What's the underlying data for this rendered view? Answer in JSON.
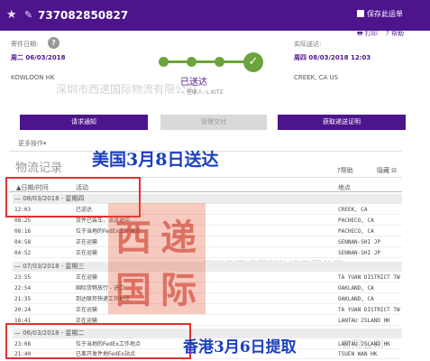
{
  "header": {
    "tracking_number": "737082850827",
    "save_label": "保存此运单"
  },
  "links": {
    "print": "打印",
    "help": "帮助"
  },
  "shipment": {
    "ship_date_label": "寄件日期:",
    "ship_date": "周二 06/03/2018",
    "origin": "KOWLOON HK",
    "delivered_label": "实际送达:",
    "delivered_date": "周四 08/03/2018 12:03",
    "destination": "CREEK, CA US"
  },
  "status": {
    "title": "已送达",
    "signed_by": "签收人: L.KITZ"
  },
  "buttons": {
    "notify": "请求通知",
    "manage": "管理交付",
    "proof": "获取递送证明"
  },
  "more_actions": "更多操作▾",
  "history": {
    "title": "物流记录",
    "help": "帮助",
    "hide": "隐藏",
    "col_date": "▲日期/时间",
    "col_activity": "活动",
    "col_location": "地点",
    "groups": [
      {
        "header": "—  08/03/2018 - 星期四",
        "rows": [
          {
            "time": "12:03",
            "activity": "已送达",
            "location": "CREEK, CA"
          },
          {
            "time": "08:25",
            "activity": "货件已装车，派送途中",
            "location": "PACHECO, CA"
          },
          {
            "time": "08:16",
            "activity": "位于当地的FedEx工作地点",
            "location": "PACHECO, CA"
          },
          {
            "time": "04:58",
            "activity": "正在运输",
            "location": "SENNAN-SHI JP"
          },
          {
            "time": "04:52",
            "activity": "正在运输",
            "location": "SENNAN-SHI JP"
          }
        ]
      },
      {
        "header": "—  07/03/2018 - 星期三",
        "rows": [
          {
            "time": "23:55",
            "activity": "正在运输",
            "location": "TA YUAN DISTRICT TW"
          },
          {
            "time": "22:54",
            "activity": "国际货物放行 - 进口",
            "location": "OAKLAND, CA"
          },
          {
            "time": "21:35",
            "activity": "到达联邦快递工作地点",
            "location": "OAKLAND, CA"
          },
          {
            "time": "20:24",
            "activity": "正在运输",
            "location": "TA YUAN DISTRICT TW"
          },
          {
            "time": "18:41",
            "activity": "正在运输",
            "location": "LANTAU ISLAND HK"
          }
        ]
      },
      {
        "header": "—  06/03/2018 - 星期二",
        "rows": [
          {
            "time": "23:08",
            "activity": "位于当地的FedEx工作地点",
            "location": "LANTAU ISLAND HK"
          },
          {
            "time": "21:40",
            "activity": "已离开发件地FedEx站点",
            "location": "TSUEN WAN HK"
          }
        ]
      }
    ]
  },
  "annotations": {
    "us": "美国3月8日送达",
    "hk": "香港3月6日提取"
  },
  "watermark": {
    "text": "深圳市西递国际物流有限公司",
    "text_cut": "深圳市西递国际物流有限公司",
    "text_short": "有限公司",
    "stamp_chars": [
      "西",
      "递",
      "国",
      "际"
    ]
  },
  "colors": {
    "brand_purple": "#4d148c",
    "progress_green": "#6ca33c",
    "annotation_blue": "#1a3fbf",
    "highlight_red": "#e03030"
  }
}
